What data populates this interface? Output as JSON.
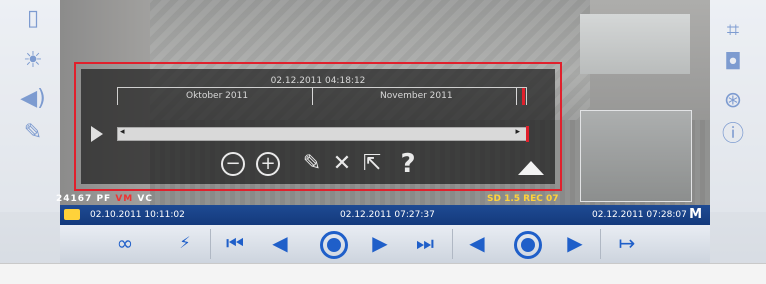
{
  "overlay": {
    "current_datetime": "02.12.2011 04:18:12",
    "months": [
      "Oktober 2011",
      "November 2011"
    ]
  },
  "osd": {
    "left_text": "24167",
    "flags": [
      "PF",
      "VM",
      "VC"
    ],
    "right_text": "SD 1.5 REC 07"
  },
  "timeline": {
    "start": "02.10.2011 10:11:02",
    "current": "02.12.2011 07:27:37",
    "end": "02.12.2011 07:28:07"
  },
  "colors": {
    "accent_blue": "#1f5fc9",
    "timeline_bar": "#1e4a93",
    "highlight_red": "#e0202c",
    "osd_yellow": "#ffd23a"
  }
}
